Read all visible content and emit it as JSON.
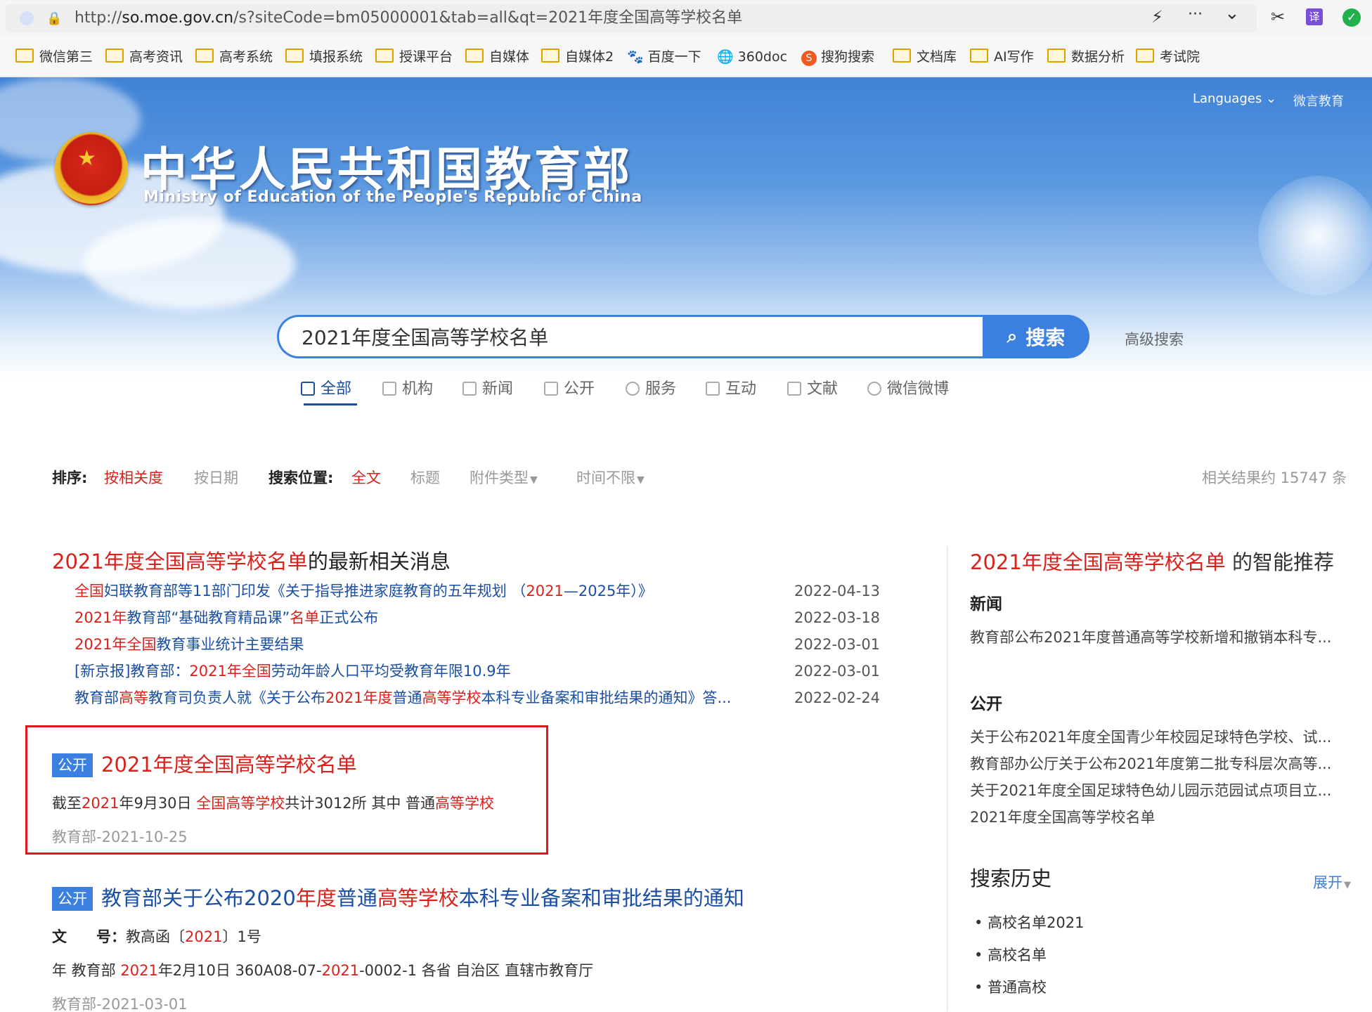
{
  "browser": {
    "url_prefix": "http://",
    "url_domain": "so.moe.gov.cn",
    "url_path": "/s?siteCode=bm05000001&tab=all&qt=2021年度全国高等学校名单",
    "right_glyphs": [
      "⚡",
      "···",
      "⌄",
      "✂",
      "译",
      "✓"
    ]
  },
  "bookmarks": [
    {
      "label": "微信第三",
      "icon": "folder-icon"
    },
    {
      "label": "高考资讯",
      "icon": "folder-icon"
    },
    {
      "label": "高考系统",
      "icon": "folder-icon"
    },
    {
      "label": "填报系统",
      "icon": "folder-icon"
    },
    {
      "label": "授课平台",
      "icon": "folder-icon"
    },
    {
      "label": "自媒体",
      "icon": "folder-icon"
    },
    {
      "label": "自媒体2",
      "icon": "folder-icon"
    },
    {
      "label": "百度一下",
      "icon": "baidu-paw-icon"
    },
    {
      "label": "360doc",
      "icon": "globe-icon"
    },
    {
      "label": "搜狗搜索",
      "icon": "sogou-icon"
    },
    {
      "label": "文档库",
      "icon": "folder-icon"
    },
    {
      "label": "AI写作",
      "icon": "folder-icon"
    },
    {
      "label": "数据分析",
      "icon": "folder-icon"
    },
    {
      "label": "考试院",
      "icon": "folder-icon"
    }
  ],
  "header": {
    "title": "中华人民共和国教育部",
    "subtitle": "Ministry of Education of the People's Republic of China",
    "languages": "Languages",
    "weiyan": "微言教育"
  },
  "search": {
    "query": "2021年度全国高等学校名单",
    "button": "搜索",
    "advanced": "高级搜索",
    "tabs": [
      "全部",
      "机构",
      "新闻",
      "公开",
      "服务",
      "互动",
      "文献",
      "微信微博"
    ]
  },
  "sortbar": {
    "sort_label": "排序:",
    "by_relevance": "按相关度",
    "by_date": "按日期",
    "position_label": "搜索位置:",
    "fulltext": "全文",
    "title": "标题",
    "attach_type": "附件类型",
    "time_range": "时间不限",
    "result_count": "相关结果约 15747 条"
  },
  "latest": {
    "title_red": "2021年度全国高等学校名单",
    "title_suffix": "的最新相关消息",
    "items": [
      {
        "segments": [
          [
            "r",
            "全国"
          ],
          [
            "b",
            "妇联教育部等11部门印发《关于指导推进家庭教育的五年规划 （"
          ],
          [
            "r",
            "2021"
          ],
          [
            "b",
            "—2025年）》"
          ]
        ],
        "date": "2022-04-13"
      },
      {
        "segments": [
          [
            "r",
            "2021年"
          ],
          [
            "b",
            "教育部“基础教育精品课”"
          ],
          [
            "r",
            "名单"
          ],
          [
            "b",
            "正式公布"
          ]
        ],
        "date": "2022-03-18"
      },
      {
        "segments": [
          [
            "r",
            "2021年全国"
          ],
          [
            "b",
            "教育事业统计主要结果"
          ]
        ],
        "date": "2022-03-01"
      },
      {
        "segments": [
          [
            "b",
            "[新京报]教育部："
          ],
          [
            "r",
            "2021年全国"
          ],
          [
            "b",
            "劳动年龄人口平均受教育年限10.9年"
          ]
        ],
        "date": "2022-03-01"
      },
      {
        "segments": [
          [
            "b",
            "教育部"
          ],
          [
            "r",
            "高等"
          ],
          [
            "b",
            "教育司负责人就《关于公布"
          ],
          [
            "r",
            "2021年度"
          ],
          [
            "b",
            "普通"
          ],
          [
            "r",
            "高等学校"
          ],
          [
            "b",
            "本科专业备案和审批结果的通知》答..."
          ]
        ],
        "date": "2022-02-24"
      }
    ]
  },
  "results": [
    {
      "badge": "公开",
      "title": "2021年度全国高等学校名单",
      "snippet": [
        [
          "n",
          "截至"
        ],
        [
          "r",
          "2021"
        ],
        [
          "n",
          "年9月30日 "
        ],
        [
          "r",
          "全国高等学校"
        ],
        [
          "n",
          "共计3012所 其中 普通"
        ],
        [
          "r",
          "高等学校"
        ]
      ],
      "meta": "教育部-2021-10-25"
    },
    {
      "badge": "公开",
      "title": [
        [
          "b",
          "教育部关于公布2020"
        ],
        [
          "r",
          "年度"
        ],
        [
          "b",
          "普通"
        ],
        [
          "r",
          "高等学校"
        ],
        [
          "b",
          "本科专业备案和审批结果的通知"
        ]
      ],
      "line1": [
        [
          "k",
          "文　　号："
        ],
        [
          "n",
          "教高函〔"
        ],
        [
          "r",
          "2021"
        ],
        [
          "n",
          "〕1号"
        ]
      ],
      "line2": [
        [
          "n",
          "年 教育部 "
        ],
        [
          "r",
          "2021"
        ],
        [
          "n",
          "年2月10日 360A08-07-"
        ],
        [
          "r",
          "2021"
        ],
        [
          "n",
          "-0002-1 各省 自治区 直辖市教育厅"
        ]
      ],
      "meta": "教育部-2021-03-01"
    }
  ],
  "sidebar": {
    "heading_red": "2021年度全国高等学校名单",
    "heading_suffix": " 的智能推荐",
    "news_label": "新闻",
    "news_items": [
      "教育部公布2021年度普通高等学校新增和撤销本科专..."
    ],
    "open_label": "公开",
    "open_items": [
      "关于公布2021年度全国青少年校园足球特色学校、试...",
      "教育部办公厅关于公布2021年度第二批专科层次高等...",
      "关于2021年度全国足球特色幼儿园示范园试点项目立...",
      "2021年度全国高等学校名单"
    ],
    "history_label": "搜索历史",
    "expand": "展开",
    "history_items": [
      "高校名单2021",
      "高校名单",
      "普通高校"
    ]
  },
  "colors": {
    "accent_blue": "#3b7fe0",
    "highlight_red": "#d9211b",
    "link_blue": "#1a4fa3",
    "box_red": "#e0171b"
  }
}
